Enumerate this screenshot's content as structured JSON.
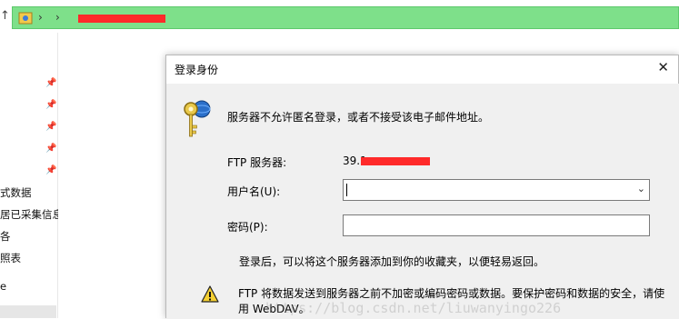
{
  "explorer": {
    "up_glyph": "↑",
    "sep_glyph": "›",
    "nav_items": [
      "式数据",
      "居已采集信息",
      "各",
      "照表",
      "e"
    ]
  },
  "dialog": {
    "title": "登录身份",
    "close_glyph": "✕",
    "message": "服务器不允许匿名登录，或者不接受该电子邮件地址。",
    "server_label": "FTP 服务器:",
    "server_value": "39.1",
    "username_label": "用户名(U):",
    "username_value": "",
    "password_label": "密码(P):",
    "password_value": "",
    "dropdown_glyph": "⌄",
    "favorites_note": "登录后，可以将这个服务器添加到你的收藏夹，以便轻易返回。",
    "warning_text": "FTP 将数据发送到服务器之前不加密或编码密码或数据。要保护密码和数据的安全，请使用 WebDAV。"
  },
  "watermark": "https://blog.csdn.net/liuwanyingo226",
  "colors": {
    "address_bar": "#7ee08a",
    "redaction": "#ff2a2a",
    "dialog_body": "#f0f0f0"
  }
}
